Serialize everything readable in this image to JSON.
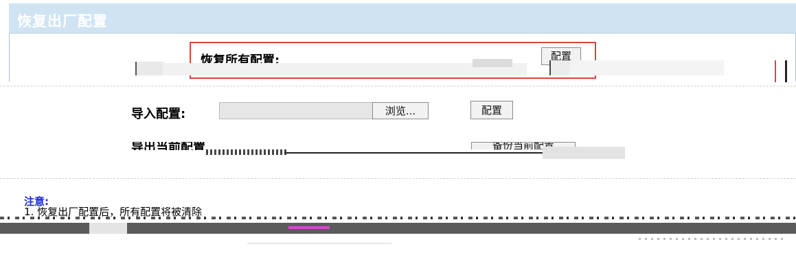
{
  "page": {
    "title": "恢复出厂配置"
  },
  "restore": {
    "label": "恢复所有配置:",
    "button": "配置"
  },
  "import": {
    "label": "导入配置:",
    "browse_button": "浏览...",
    "config_button": "配置"
  },
  "export": {
    "label": "导出当前配置",
    "button": "备份当前配置"
  },
  "notes": {
    "title": "注意:",
    "line1": "1. 恢复出厂配置后，所有配置将被清除"
  },
  "colors": {
    "header_bg": "#cfe3f3",
    "highlight_border": "#e0413b",
    "note_title": "#1b2bd6"
  }
}
